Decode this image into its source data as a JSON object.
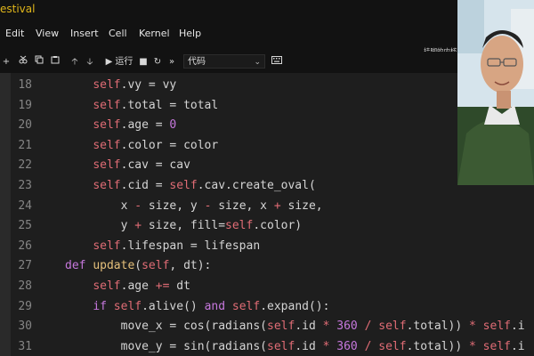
{
  "window": {
    "title": "estival"
  },
  "menu": {
    "items": [
      "Edit",
      "View",
      "Insert",
      "Cell",
      "Kernel",
      "Help"
    ]
  },
  "toolbar": {
    "run_label": "▶ 运行",
    "cell_type": "代码"
  },
  "status": {
    "kernel_text": "挂脚的内核",
    "trusted_text": "可信"
  },
  "editor": {
    "lines": [
      {
        "n": "18",
        "indent": 4,
        "tokens": [
          [
            "self",
            "self"
          ],
          [
            "plain",
            ".vy = vy"
          ]
        ]
      },
      {
        "n": "19",
        "indent": 4,
        "tokens": [
          [
            "self",
            "self"
          ],
          [
            "plain",
            ".total = total"
          ]
        ]
      },
      {
        "n": "20",
        "indent": 4,
        "tokens": [
          [
            "self",
            "self"
          ],
          [
            "plain",
            ".age = "
          ],
          [
            "num",
            "0"
          ]
        ]
      },
      {
        "n": "21",
        "indent": 4,
        "tokens": [
          [
            "self",
            "self"
          ],
          [
            "plain",
            ".color = color"
          ]
        ]
      },
      {
        "n": "22",
        "indent": 4,
        "tokens": [
          [
            "self",
            "self"
          ],
          [
            "plain",
            ".cav = cav"
          ]
        ]
      },
      {
        "n": "23",
        "indent": 4,
        "tokens": [
          [
            "self",
            "self"
          ],
          [
            "plain",
            ".cid = "
          ],
          [
            "self",
            "self"
          ],
          [
            "plain",
            ".cav.create_oval("
          ]
        ]
      },
      {
        "n": "24",
        "indent": 8,
        "tokens": [
          [
            "plain",
            "x "
          ],
          [
            "op",
            "-"
          ],
          [
            "plain",
            " size, y "
          ],
          [
            "op",
            "-"
          ],
          [
            "plain",
            " size, x "
          ],
          [
            "op",
            "+"
          ],
          [
            "plain",
            " size,"
          ]
        ]
      },
      {
        "n": "25",
        "indent": 8,
        "tokens": [
          [
            "plain",
            "y "
          ],
          [
            "op",
            "+"
          ],
          [
            "plain",
            " size, fill="
          ],
          [
            "self",
            "self"
          ],
          [
            "plain",
            ".color)"
          ]
        ]
      },
      {
        "n": "26",
        "indent": 4,
        "tokens": [
          [
            "self",
            "self"
          ],
          [
            "plain",
            ".lifespan = lifespan"
          ]
        ]
      },
      {
        "n": "27",
        "indent": 0,
        "tokens": [
          [
            "kw",
            "def"
          ],
          [
            "plain",
            " "
          ],
          [
            "fn",
            "update"
          ],
          [
            "plain",
            "("
          ],
          [
            "self",
            "self"
          ],
          [
            "plain",
            ", dt):"
          ]
        ]
      },
      {
        "n": "28",
        "indent": 4,
        "tokens": [
          [
            "self",
            "self"
          ],
          [
            "plain",
            ".age "
          ],
          [
            "op",
            "+="
          ],
          [
            "plain",
            " dt"
          ]
        ]
      },
      {
        "n": "29",
        "indent": 4,
        "tokens": [
          [
            "kw",
            "if"
          ],
          [
            "plain",
            " "
          ],
          [
            "self",
            "self"
          ],
          [
            "plain",
            ".alive() "
          ],
          [
            "kw",
            "and"
          ],
          [
            "plain",
            " "
          ],
          [
            "self",
            "self"
          ],
          [
            "plain",
            ".expand():"
          ]
        ]
      },
      {
        "n": "30",
        "indent": 8,
        "tokens": [
          [
            "plain",
            "move_x = cos(radians("
          ],
          [
            "self",
            "self"
          ],
          [
            "plain",
            ".id "
          ],
          [
            "op",
            "*"
          ],
          [
            "plain",
            " "
          ],
          [
            "num",
            "360"
          ],
          [
            "plain",
            " "
          ],
          [
            "op",
            "/"
          ],
          [
            "plain",
            " "
          ],
          [
            "self",
            "self"
          ],
          [
            "plain",
            ".total)) "
          ],
          [
            "op",
            "*"
          ],
          [
            "plain",
            " "
          ],
          [
            "self",
            "self"
          ],
          [
            "plain",
            ".i"
          ]
        ]
      },
      {
        "n": "31",
        "indent": 8,
        "tokens": [
          [
            "plain",
            "move_y = sin(radians("
          ],
          [
            "self",
            "self"
          ],
          [
            "plain",
            ".id "
          ],
          [
            "op",
            "*"
          ],
          [
            "plain",
            " "
          ],
          [
            "num",
            "360"
          ],
          [
            "plain",
            " "
          ],
          [
            "op",
            "/"
          ],
          [
            "plain",
            " "
          ],
          [
            "self",
            "self"
          ],
          [
            "plain",
            ".total)) "
          ],
          [
            "op",
            "*"
          ],
          [
            "plain",
            " "
          ],
          [
            "self",
            "self"
          ],
          [
            "plain",
            ".i"
          ]
        ]
      }
    ]
  }
}
